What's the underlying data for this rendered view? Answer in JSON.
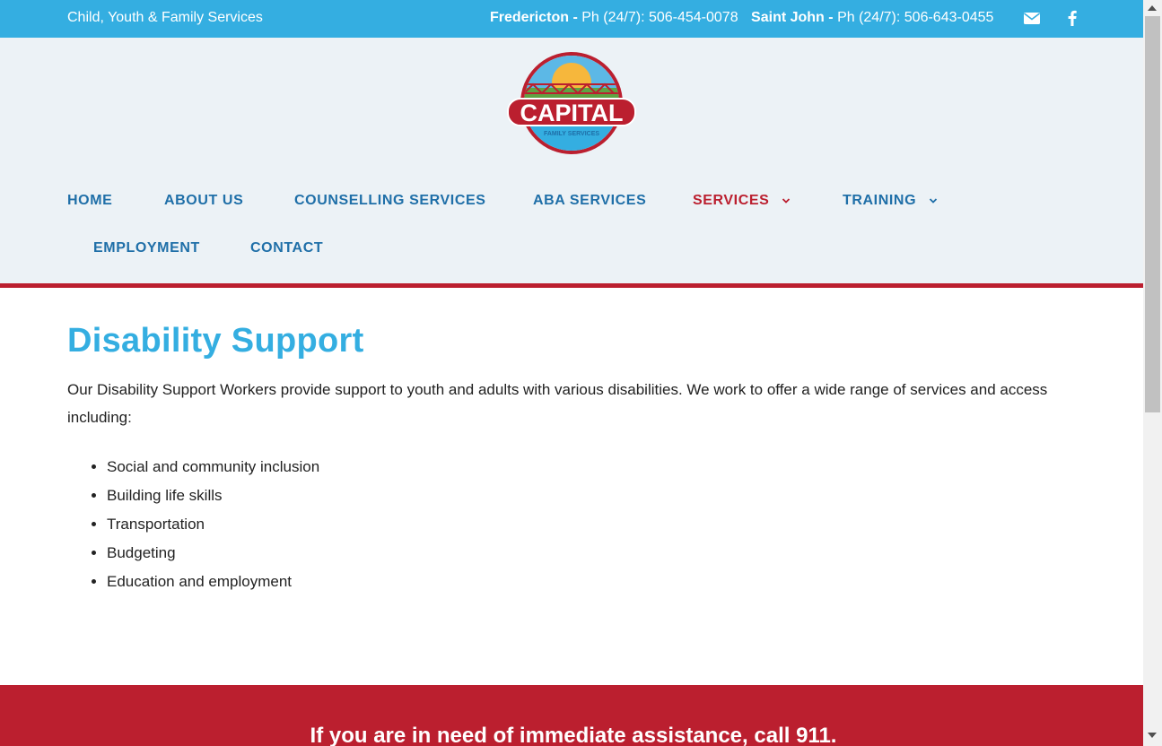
{
  "topbar": {
    "tagline": "Child, Youth & Family Services",
    "phones": [
      {
        "city": "Fredericton -",
        "number": "Ph (24/7): 506-454-0078"
      },
      {
        "city": "Saint John -",
        "number": "Ph (24/7): 506-643-0455"
      }
    ],
    "icons": [
      "envelope-icon",
      "facebook-icon"
    ]
  },
  "logo": {
    "word": "CAPITAL",
    "subtext": "FAMILY SERVICES"
  },
  "nav": {
    "items": [
      {
        "label": "HOME"
      },
      {
        "label": "ABOUT US"
      },
      {
        "label": "COUNSELLING SERVICES"
      },
      {
        "label": "ABA SERVICES"
      },
      {
        "label": "SERVICES",
        "active": true,
        "has_dropdown": true
      },
      {
        "label": "TRAINING",
        "has_dropdown": true
      },
      {
        "label": "EMPLOYMENT"
      },
      {
        "label": "CONTACT"
      }
    ]
  },
  "main": {
    "title": "Disability Support",
    "intro": "Our Disability Support Workers provide support to youth and adults with various disabilities. We work to offer a wide range of services and access including:",
    "list": [
      "Social and community inclusion",
      "Building life skills",
      "Transportation",
      "Budgeting",
      "Education and employment"
    ]
  },
  "footer": {
    "emergency": "If you are in need of immediate assistance, call 911."
  },
  "colors": {
    "topbar": "#34aee1",
    "header_bg": "#ecf2f6",
    "nav_text": "#1f6fa8",
    "accent_red": "#bb1f2f",
    "title": "#34aee1"
  }
}
